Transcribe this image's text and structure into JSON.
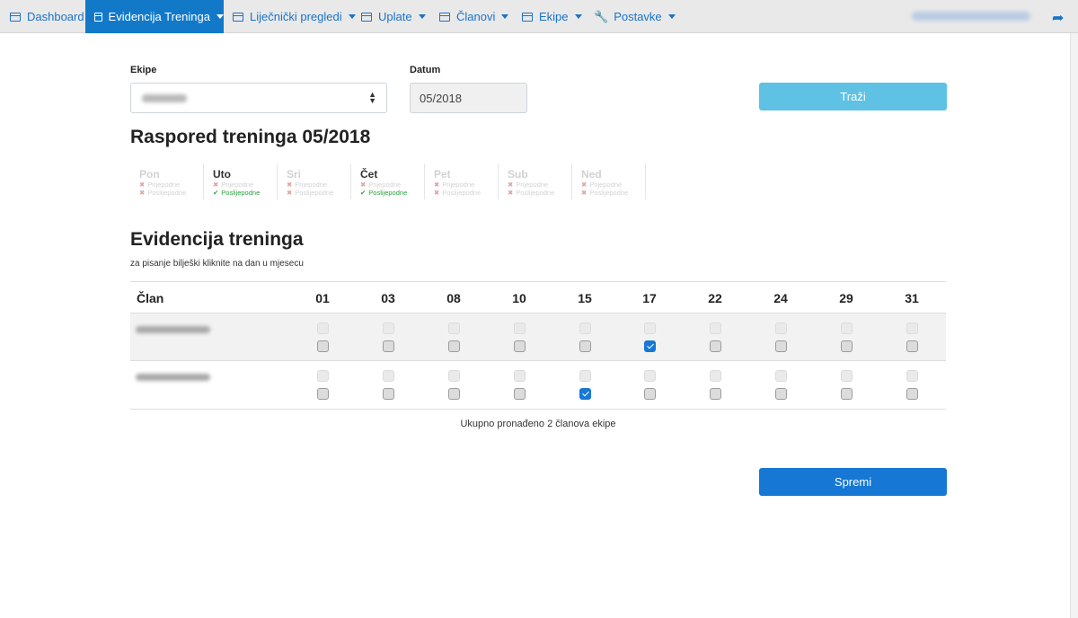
{
  "nav": {
    "items": [
      {
        "label": "Dashboard",
        "icon": "table-icon",
        "caret": false,
        "active": false
      },
      {
        "label": "Evidencija Treninga",
        "icon": "table-icon",
        "caret": true,
        "active": true
      },
      {
        "label": "Liječnički pregledi",
        "icon": "table-icon",
        "caret": true,
        "active": false
      },
      {
        "label": "Uplate",
        "icon": "table-icon",
        "caret": true,
        "active": false
      },
      {
        "label": "Članovi",
        "icon": "table-icon",
        "caret": true,
        "active": false
      },
      {
        "label": "Ekipe",
        "icon": "table-icon",
        "caret": true,
        "active": false
      },
      {
        "label": "Postavke",
        "icon": "wrench-icon",
        "caret": true,
        "active": false
      }
    ],
    "logout_icon": "sign-out-icon"
  },
  "form": {
    "team_label": "Ekipe",
    "date_label": "Datum",
    "date_value": "05/2018",
    "search_label": "Traži"
  },
  "schedule": {
    "title": "Raspored treninga 05/2018",
    "morning_label": "Prijepodne",
    "afternoon_label": "Poslijepodne",
    "days": [
      {
        "name": "Pon",
        "morning": false,
        "afternoon": false
      },
      {
        "name": "Uto",
        "morning": false,
        "afternoon": true
      },
      {
        "name": "Sri",
        "morning": false,
        "afternoon": false
      },
      {
        "name": "Čet",
        "morning": false,
        "afternoon": true
      },
      {
        "name": "Pet",
        "morning": false,
        "afternoon": false
      },
      {
        "name": "Sub",
        "morning": false,
        "afternoon": false
      },
      {
        "name": "Ned",
        "morning": false,
        "afternoon": false
      }
    ]
  },
  "attendance": {
    "title": "Evidencija treninga",
    "subtitle": "za pisanje bilješki kliknite na dan u mjesecu",
    "member_col": "Član",
    "days": [
      "01",
      "03",
      "08",
      "10",
      "15",
      "17",
      "22",
      "24",
      "29",
      "31"
    ],
    "rows": [
      {
        "checked_pm": [
          "17"
        ]
      },
      {
        "checked_pm": [
          "15"
        ]
      }
    ],
    "total": "Ukupno pronađeno 2 članova ekipe"
  },
  "save_label": "Spremi",
  "colors": {
    "nav_active": "#1279c9",
    "nav_link": "#1a73c9",
    "search_button": "#5fc1e4",
    "save_button": "#1677d4",
    "check_ok": "#2aa040",
    "check_no": "#e3a0a0"
  }
}
